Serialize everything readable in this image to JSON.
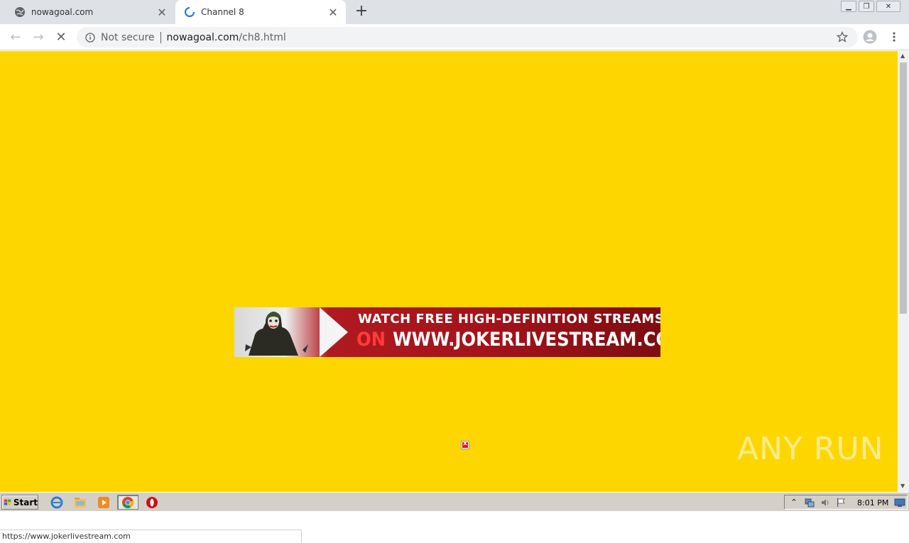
{
  "browser": {
    "tabs": [
      {
        "title": "nowagoal.com",
        "favicon": "globe-icon",
        "active": false
      },
      {
        "title": "Channel 8",
        "favicon": "loading-spinner-icon",
        "active": true
      }
    ],
    "new_tab_label": "+",
    "address": {
      "security_label": "Not secure",
      "host": "nowagoal.com",
      "path": "/ch8.html"
    },
    "status_url": "https://www.jokerlivestream.com"
  },
  "page": {
    "background_color": "#fdd600",
    "banner": {
      "line1": "WATCH FREE HIGH-DEFINITION STREAMS",
      "on": "ON",
      "url": "WWW.JOKERLIVESTREAM.COM"
    },
    "watermark": "ANY RUN"
  },
  "taskbar": {
    "start_label": "Start",
    "clock": "8:01 PM",
    "apps": [
      "ie-icon",
      "explorer-icon",
      "media-player-icon",
      "chrome-icon",
      "opera-icon"
    ]
  }
}
